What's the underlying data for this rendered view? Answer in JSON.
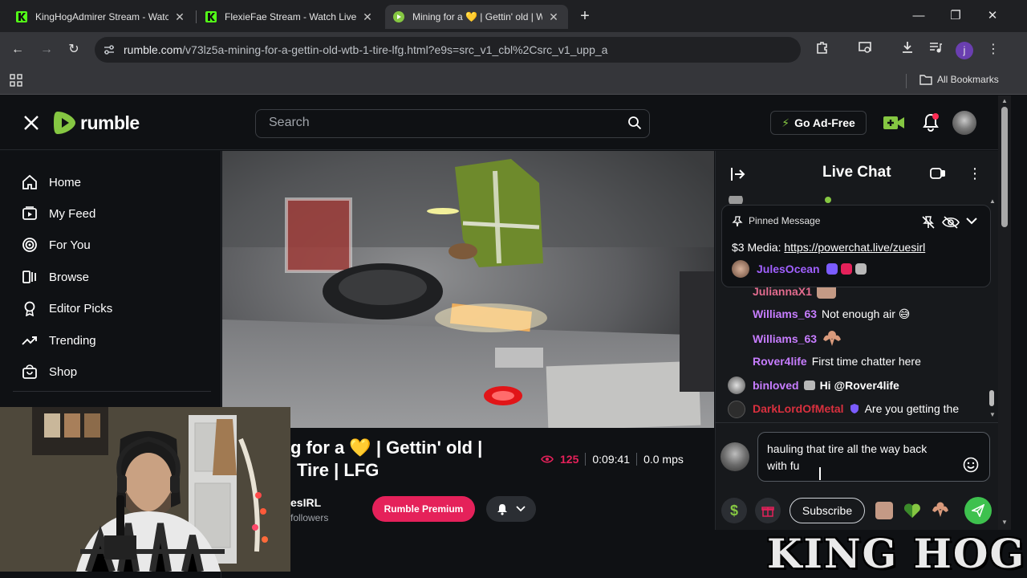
{
  "browser": {
    "tabs": [
      {
        "title": "KingHogAdmirer Stream - Watch",
        "active": false
      },
      {
        "title": "FlexieFae Stream - Watch Live o",
        "active": false
      },
      {
        "title": "Mining for a 💛 | Gettin' old | W",
        "active": true
      }
    ],
    "url_host": "rumble.com",
    "url_path": "/v73lz5a-mining-for-a-gettin-old-wtb-1-tire-lfg.html?e9s=src_v1_cbl%2Csrc_v1_upp_a",
    "all_bookmarks_label": "All Bookmarks",
    "profile_initial": "j"
  },
  "header": {
    "logo_text": "rumble",
    "search_placeholder": "Search",
    "go_ad_free_label": "Go Ad-Free"
  },
  "sidebar": {
    "items": [
      {
        "label": "Home",
        "icon": "home-icon"
      },
      {
        "label": "My Feed",
        "icon": "feed-icon"
      },
      {
        "label": "For You",
        "icon": "target-icon"
      },
      {
        "label": "Browse",
        "icon": "browse-icon"
      },
      {
        "label": "Editor Picks",
        "icon": "award-icon"
      },
      {
        "label": "Trending",
        "icon": "trending-icon"
      },
      {
        "label": "Shop",
        "icon": "shop-icon"
      }
    ]
  },
  "video": {
    "title_line1": "g for a 💛 | Gettin' old |",
    "title_line2": "Tire | LFG",
    "viewers": "125",
    "duration": "0:09:41",
    "mps": "0.0 mps",
    "channel_name": "esIRL",
    "followers": "followers",
    "rumble_premium_label": "Rumble Premium"
  },
  "chat": {
    "title": "Live Chat",
    "pinned": {
      "header": "Pinned Message",
      "text_prefix": "$3 Media: ",
      "link": "https://powerchat.live/zuesirl",
      "user": "JulesOcean"
    },
    "messages": [
      {
        "user": "JuliannaX1",
        "text": "",
        "color": "#e26b8e"
      },
      {
        "user": "Williams_63",
        "text": "Not enough air 😅",
        "color": "#c77dff"
      },
      {
        "user": "Williams_63",
        "text": "",
        "color": "#c77dff"
      },
      {
        "user": "Rover4life",
        "text": "First time chatter here",
        "color": "#c77dff"
      },
      {
        "user": "binloved",
        "text": "Hi @Rover4life",
        "color": "#c77dff"
      },
      {
        "user": "DarkLordOfMetal",
        "text": "Are you getting the",
        "color": "#d9303e"
      }
    ],
    "input_text": "hauling that tire all the way back with fu",
    "subscribe_label": "Subscribe"
  },
  "overlay": {
    "brand_text": "KING HOG"
  },
  "colors": {
    "rumble_green": "#85c742",
    "premium_pink": "#e5215a",
    "send_green": "#3ec14e"
  }
}
